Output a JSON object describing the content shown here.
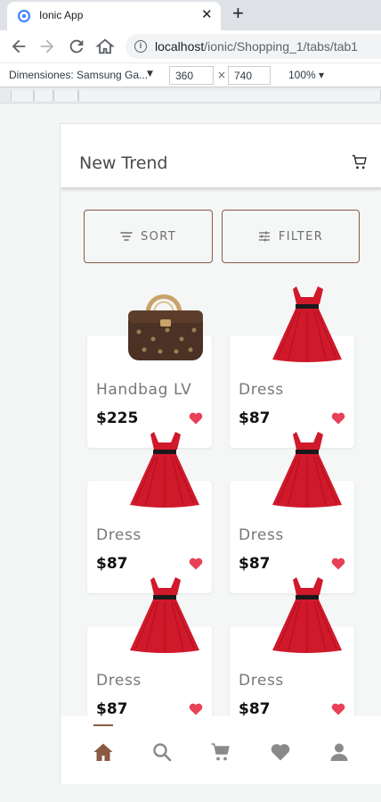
{
  "browser": {
    "tab_title": "Ionic App",
    "url_host": "localhost",
    "url_path": "/ionic/Shopping_1/tabs/tab1",
    "device_label": "Dimensiones: Samsung Ga...",
    "width": "360",
    "height": "740",
    "zoom": "100%"
  },
  "header": {
    "title": "New Trend"
  },
  "buttons": {
    "sort": "SORT",
    "filter": "FILTER"
  },
  "products": [
    {
      "name": "Handbag LV",
      "price": "$225",
      "image": "handbag",
      "favorite": true
    },
    {
      "name": "Dress",
      "price": "$87",
      "image": "dress",
      "favorite": true
    },
    {
      "name": "Dress",
      "price": "$87",
      "image": "dress",
      "favorite": true
    },
    {
      "name": "Dress",
      "price": "$87",
      "image": "dress",
      "favorite": true
    },
    {
      "name": "Dress",
      "price": "$87",
      "image": "dress",
      "favorite": true
    },
    {
      "name": "Dress",
      "price": "$87",
      "image": "dress",
      "favorite": true
    }
  ],
  "tabs": [
    {
      "icon": "home-icon",
      "active": true
    },
    {
      "icon": "search-icon",
      "active": false
    },
    {
      "icon": "cart-icon",
      "active": false
    },
    {
      "icon": "heart-icon",
      "active": false
    },
    {
      "icon": "person-icon",
      "active": false
    }
  ],
  "colors": {
    "accent": "#8a5a44",
    "heart": "#e84057",
    "inactive_tab": "#8a8a8a"
  }
}
